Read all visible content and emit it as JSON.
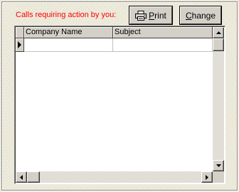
{
  "caption": "Calls requiring action by you:",
  "buttons": {
    "print": {
      "pre": "",
      "mnemonic": "P",
      "post": "rint"
    },
    "change": {
      "pre": "",
      "mnemonic": "C",
      "post": "hange"
    }
  },
  "grid": {
    "columns": [
      "Company Name",
      "Subject"
    ],
    "rows": [
      {
        "company": "",
        "subject": ""
      }
    ]
  },
  "colors": {
    "caption": "#ff0000",
    "background": "#ece9d8",
    "button_face": "#d4d0c8"
  },
  "icons": {
    "print_button": "printer-icon",
    "current_row": "row-pointer-icon",
    "scroll_up": "arrow-up-icon",
    "scroll_down": "arrow-down-icon",
    "scroll_left": "arrow-left-icon",
    "scroll_right": "arrow-right-icon"
  }
}
